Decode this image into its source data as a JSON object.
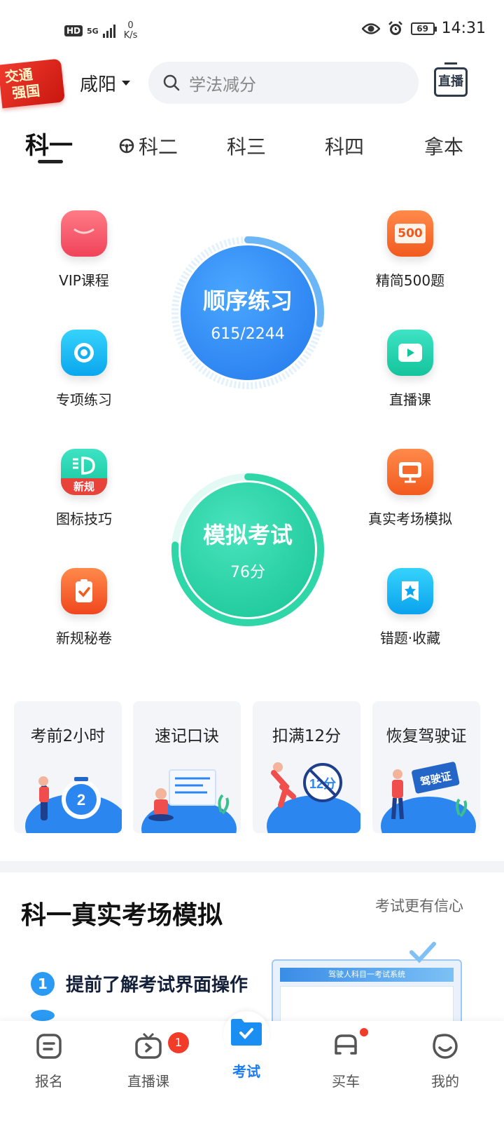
{
  "status_bar": {
    "hd": "HD",
    "network": "5G",
    "speed_value": "0",
    "speed_unit": "K/s",
    "battery": "69",
    "time": "14:31"
  },
  "header": {
    "badge_line1": "交通",
    "badge_line2": "强国",
    "city": "咸阳",
    "search_placeholder": "学法减分",
    "live_button": "直播"
  },
  "tabs": [
    {
      "label": "科一"
    },
    {
      "label": "科二"
    },
    {
      "label": "科三"
    },
    {
      "label": "科四"
    },
    {
      "label": "拿本"
    }
  ],
  "features": {
    "vip": "VIP课程",
    "jingjian": "精简500题",
    "jingjian_badge": "500",
    "zhuanxiang": "专项练习",
    "zhibo": "直播课",
    "tubiao": "图标技巧",
    "tubiao_badge": "新规",
    "zhenshi": "真实考场模拟",
    "mijuan": "新规秘卷",
    "cuoti": "错题·收藏"
  },
  "practice": {
    "title": "顺序练习",
    "progress": "615/2244",
    "progress_fraction": 0.274
  },
  "exam": {
    "title": "模拟考试",
    "score": "76分",
    "score_fraction": 0.76
  },
  "cards": [
    {
      "title": "考前2小时",
      "art": "2"
    },
    {
      "title": "速记口诀",
      "art": ""
    },
    {
      "title": "扣满12分",
      "art": "12分"
    },
    {
      "title": "恢复驾驶证",
      "art": "驾驶证"
    }
  ],
  "section": {
    "title": "科一真实考场模拟",
    "subtitle": "考试更有信心",
    "items": [
      {
        "num": "1",
        "text": "提前了解考试界面操作"
      }
    ],
    "preview_caption": "驾驶人科目一考试系统"
  },
  "bottom_nav": [
    {
      "label": "报名"
    },
    {
      "label": "直播课",
      "badge": "1"
    },
    {
      "label": "考试"
    },
    {
      "label": "买车"
    },
    {
      "label": "我的"
    }
  ],
  "colors": {
    "accent": "#1b7bf0",
    "practice": "#2f8ef0",
    "exam": "#2fd6a8",
    "badge_red": "#f23c2a"
  }
}
